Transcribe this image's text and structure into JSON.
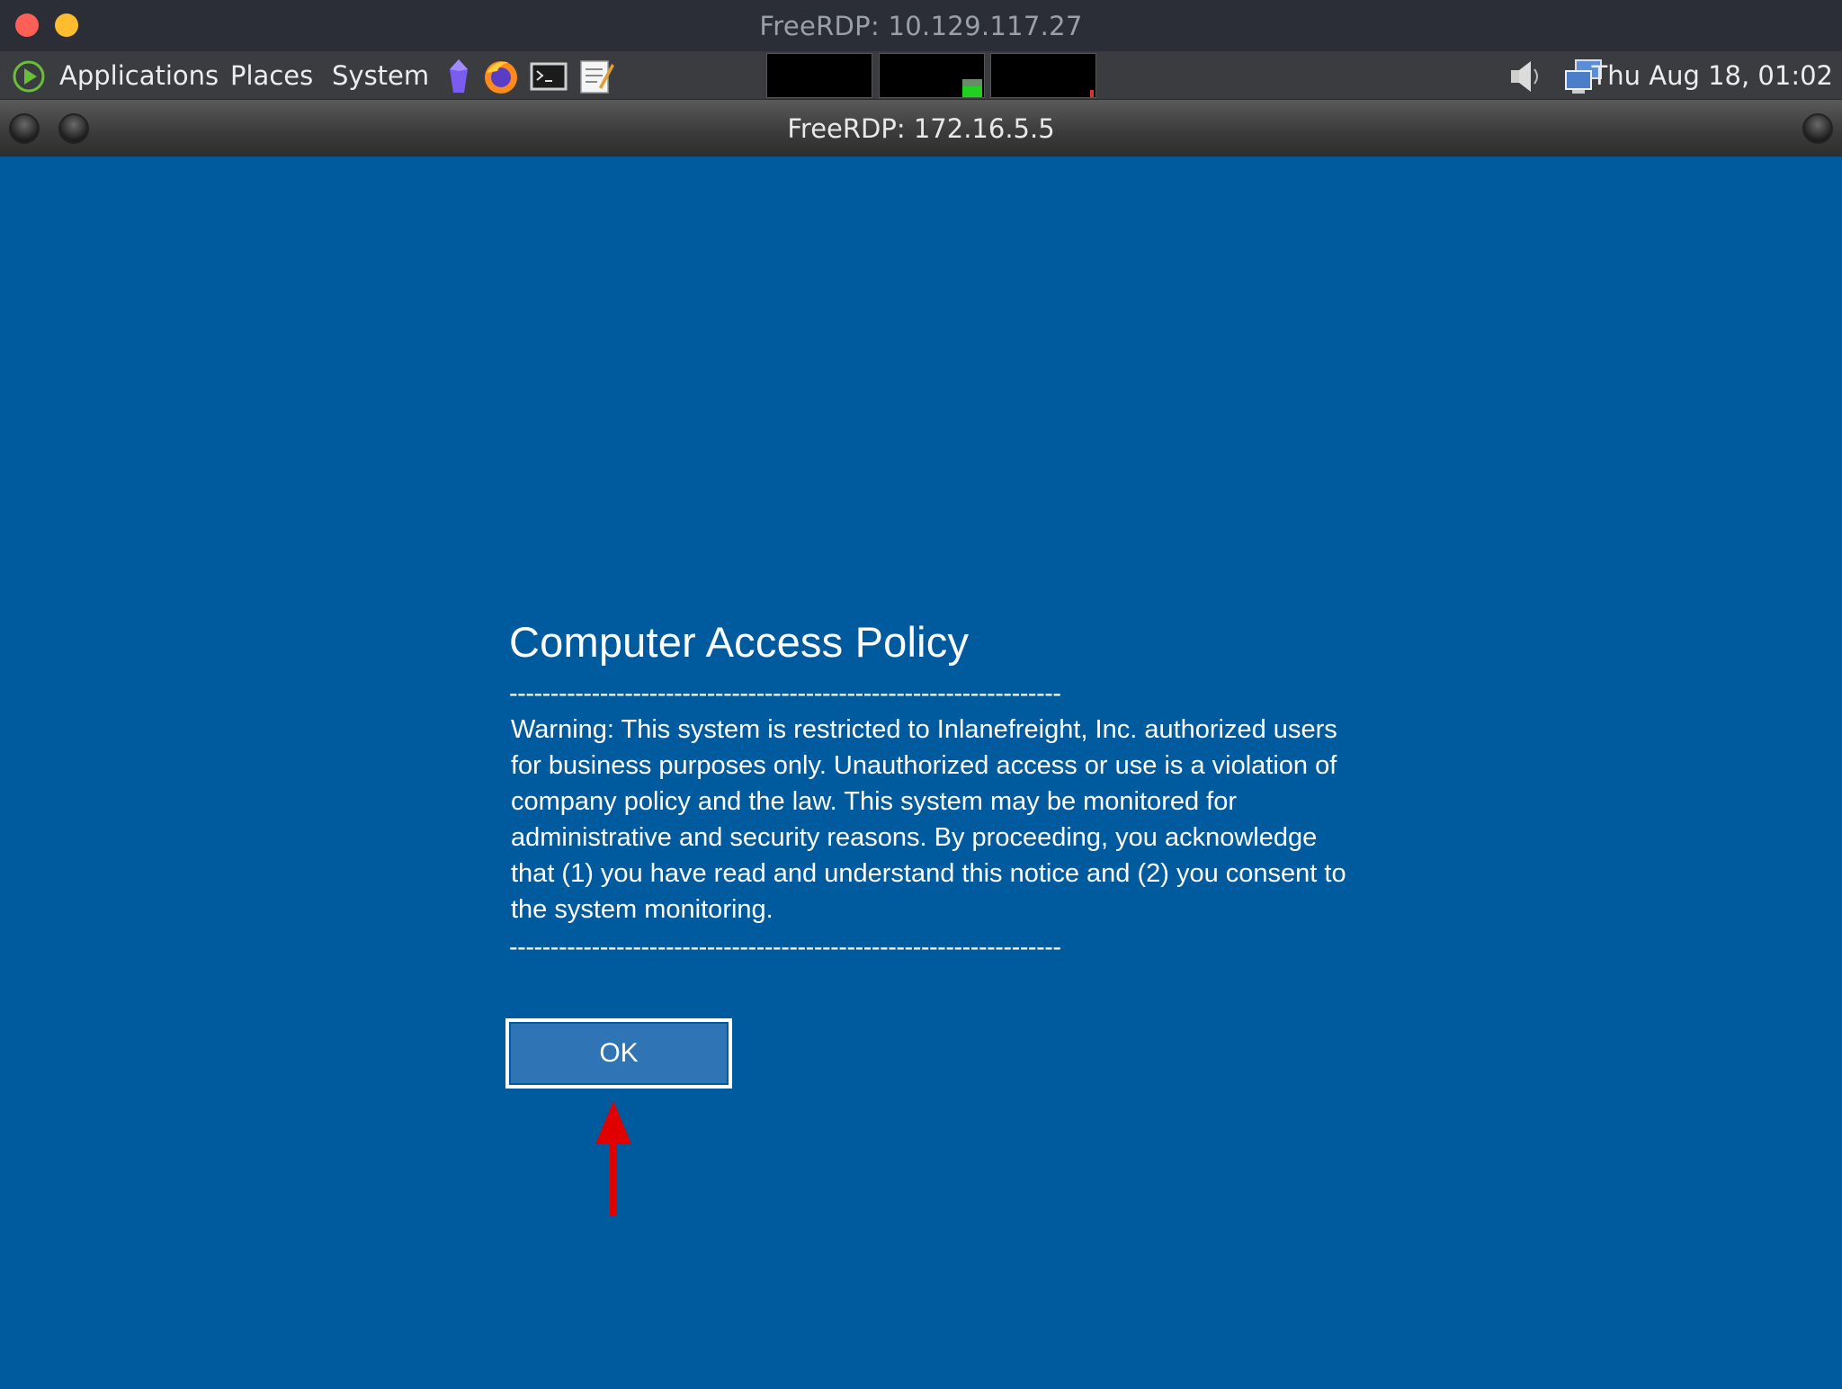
{
  "outer_window": {
    "title": "FreeRDP: 10.129.117.27"
  },
  "panel": {
    "menus": [
      {
        "label": "Applications"
      },
      {
        "label": "Places"
      },
      {
        "label": "System"
      }
    ],
    "launchers": [
      "gem-icon",
      "firefox-icon",
      "terminal-icon",
      "text-editor-icon"
    ],
    "clock": "Thu Aug 18, 01:02"
  },
  "inner_window": {
    "title": "FreeRDP: 172.16.5.5"
  },
  "policy": {
    "title": "Computer Access Policy",
    "rule": "-------------------------------------------------------------------",
    "body": "Warning: This system is restricted to Inlanefreight, Inc. authorized users for business purposes only. Unauthorized access or use is a violation of company policy and the law. This system may be monitored for administrative and security reasons. By proceeding, you acknowledge that (1) you have read and understand this notice and (2) you consent to the system monitoring.",
    "ok_label": "OK"
  },
  "colors": {
    "desktop_bg": "#005a9e",
    "button_bg": "#2f75b5",
    "annotation_arrow": "#e00000"
  }
}
